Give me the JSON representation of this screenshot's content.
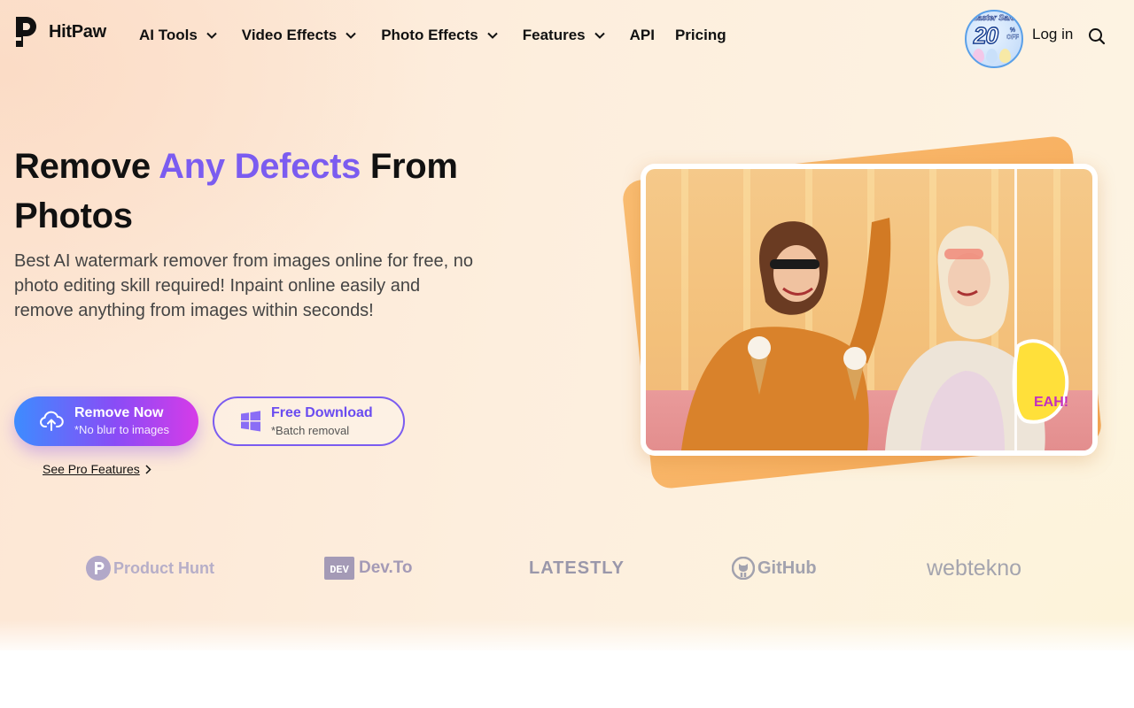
{
  "nav": {
    "logo_text": "HitPaw",
    "menu": [
      {
        "label": "AI Tools",
        "dropdown": true
      },
      {
        "label": "Video Effects",
        "dropdown": true
      },
      {
        "label": "Photo Effects",
        "dropdown": true
      },
      {
        "label": "Features",
        "dropdown": true
      },
      {
        "label": "API",
        "dropdown": false
      },
      {
        "label": "Pricing",
        "dropdown": false
      }
    ],
    "promo": {
      "top": "Easter Sales",
      "number": "20",
      "suffix_top": "%",
      "suffix_bottom": "OFF"
    },
    "login_label": "Log in",
    "search_icon": "search-icon"
  },
  "hero": {
    "headline_part1": "Remove ",
    "headline_accent": "Any Defects",
    "headline_part2": " From Photos",
    "subtext": "Best AI watermark remover from images online for free, no photo editing skill required! Inpaint online easily and remove anything from images within seconds!",
    "primary_button": {
      "label": "Remove Now",
      "sublabel": "*No blur to images",
      "icon": "upload-cloud-icon"
    },
    "secondary_button": {
      "label": "Free Download",
      "sublabel": "*Batch removal",
      "icon": "windows-icon"
    },
    "pro_link": "See Pro Features"
  },
  "logos": {
    "items": [
      "Product Hunt",
      "Dev.To",
      "LATESTLY",
      "GitHub",
      "webtekno"
    ]
  },
  "colors": {
    "accent": "#7b5cf0",
    "primary_gradient_start": "#3d8cff",
    "primary_gradient_end": "#d63be8",
    "orange_card": "#f6a24a"
  }
}
